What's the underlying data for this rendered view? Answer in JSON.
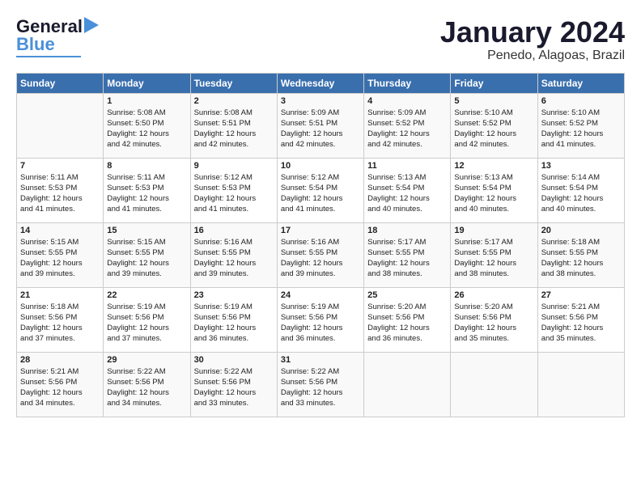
{
  "header": {
    "logo_general": "General",
    "logo_blue": "Blue",
    "month_title": "January 2024",
    "location": "Penedo, Alagoas, Brazil"
  },
  "days_of_week": [
    "Sunday",
    "Monday",
    "Tuesday",
    "Wednesday",
    "Thursday",
    "Friday",
    "Saturday"
  ],
  "weeks": [
    [
      {
        "day": "",
        "info": ""
      },
      {
        "day": "1",
        "info": "Sunrise: 5:08 AM\nSunset: 5:50 PM\nDaylight: 12 hours\nand 42 minutes."
      },
      {
        "day": "2",
        "info": "Sunrise: 5:08 AM\nSunset: 5:51 PM\nDaylight: 12 hours\nand 42 minutes."
      },
      {
        "day": "3",
        "info": "Sunrise: 5:09 AM\nSunset: 5:51 PM\nDaylight: 12 hours\nand 42 minutes."
      },
      {
        "day": "4",
        "info": "Sunrise: 5:09 AM\nSunset: 5:52 PM\nDaylight: 12 hours\nand 42 minutes."
      },
      {
        "day": "5",
        "info": "Sunrise: 5:10 AM\nSunset: 5:52 PM\nDaylight: 12 hours\nand 42 minutes."
      },
      {
        "day": "6",
        "info": "Sunrise: 5:10 AM\nSunset: 5:52 PM\nDaylight: 12 hours\nand 41 minutes."
      }
    ],
    [
      {
        "day": "7",
        "info": "Sunrise: 5:11 AM\nSunset: 5:53 PM\nDaylight: 12 hours\nand 41 minutes."
      },
      {
        "day": "8",
        "info": "Sunrise: 5:11 AM\nSunset: 5:53 PM\nDaylight: 12 hours\nand 41 minutes."
      },
      {
        "day": "9",
        "info": "Sunrise: 5:12 AM\nSunset: 5:53 PM\nDaylight: 12 hours\nand 41 minutes."
      },
      {
        "day": "10",
        "info": "Sunrise: 5:12 AM\nSunset: 5:54 PM\nDaylight: 12 hours\nand 41 minutes."
      },
      {
        "day": "11",
        "info": "Sunrise: 5:13 AM\nSunset: 5:54 PM\nDaylight: 12 hours\nand 40 minutes."
      },
      {
        "day": "12",
        "info": "Sunrise: 5:13 AM\nSunset: 5:54 PM\nDaylight: 12 hours\nand 40 minutes."
      },
      {
        "day": "13",
        "info": "Sunrise: 5:14 AM\nSunset: 5:54 PM\nDaylight: 12 hours\nand 40 minutes."
      }
    ],
    [
      {
        "day": "14",
        "info": "Sunrise: 5:15 AM\nSunset: 5:55 PM\nDaylight: 12 hours\nand 39 minutes."
      },
      {
        "day": "15",
        "info": "Sunrise: 5:15 AM\nSunset: 5:55 PM\nDaylight: 12 hours\nand 39 minutes."
      },
      {
        "day": "16",
        "info": "Sunrise: 5:16 AM\nSunset: 5:55 PM\nDaylight: 12 hours\nand 39 minutes."
      },
      {
        "day": "17",
        "info": "Sunrise: 5:16 AM\nSunset: 5:55 PM\nDaylight: 12 hours\nand 39 minutes."
      },
      {
        "day": "18",
        "info": "Sunrise: 5:17 AM\nSunset: 5:55 PM\nDaylight: 12 hours\nand 38 minutes."
      },
      {
        "day": "19",
        "info": "Sunrise: 5:17 AM\nSunset: 5:55 PM\nDaylight: 12 hours\nand 38 minutes."
      },
      {
        "day": "20",
        "info": "Sunrise: 5:18 AM\nSunset: 5:55 PM\nDaylight: 12 hours\nand 38 minutes."
      }
    ],
    [
      {
        "day": "21",
        "info": "Sunrise: 5:18 AM\nSunset: 5:56 PM\nDaylight: 12 hours\nand 37 minutes."
      },
      {
        "day": "22",
        "info": "Sunrise: 5:19 AM\nSunset: 5:56 PM\nDaylight: 12 hours\nand 37 minutes."
      },
      {
        "day": "23",
        "info": "Sunrise: 5:19 AM\nSunset: 5:56 PM\nDaylight: 12 hours\nand 36 minutes."
      },
      {
        "day": "24",
        "info": "Sunrise: 5:19 AM\nSunset: 5:56 PM\nDaylight: 12 hours\nand 36 minutes."
      },
      {
        "day": "25",
        "info": "Sunrise: 5:20 AM\nSunset: 5:56 PM\nDaylight: 12 hours\nand 36 minutes."
      },
      {
        "day": "26",
        "info": "Sunrise: 5:20 AM\nSunset: 5:56 PM\nDaylight: 12 hours\nand 35 minutes."
      },
      {
        "day": "27",
        "info": "Sunrise: 5:21 AM\nSunset: 5:56 PM\nDaylight: 12 hours\nand 35 minutes."
      }
    ],
    [
      {
        "day": "28",
        "info": "Sunrise: 5:21 AM\nSunset: 5:56 PM\nDaylight: 12 hours\nand 34 minutes."
      },
      {
        "day": "29",
        "info": "Sunrise: 5:22 AM\nSunset: 5:56 PM\nDaylight: 12 hours\nand 34 minutes."
      },
      {
        "day": "30",
        "info": "Sunrise: 5:22 AM\nSunset: 5:56 PM\nDaylight: 12 hours\nand 33 minutes."
      },
      {
        "day": "31",
        "info": "Sunrise: 5:22 AM\nSunset: 5:56 PM\nDaylight: 12 hours\nand 33 minutes."
      },
      {
        "day": "",
        "info": ""
      },
      {
        "day": "",
        "info": ""
      },
      {
        "day": "",
        "info": ""
      }
    ]
  ]
}
